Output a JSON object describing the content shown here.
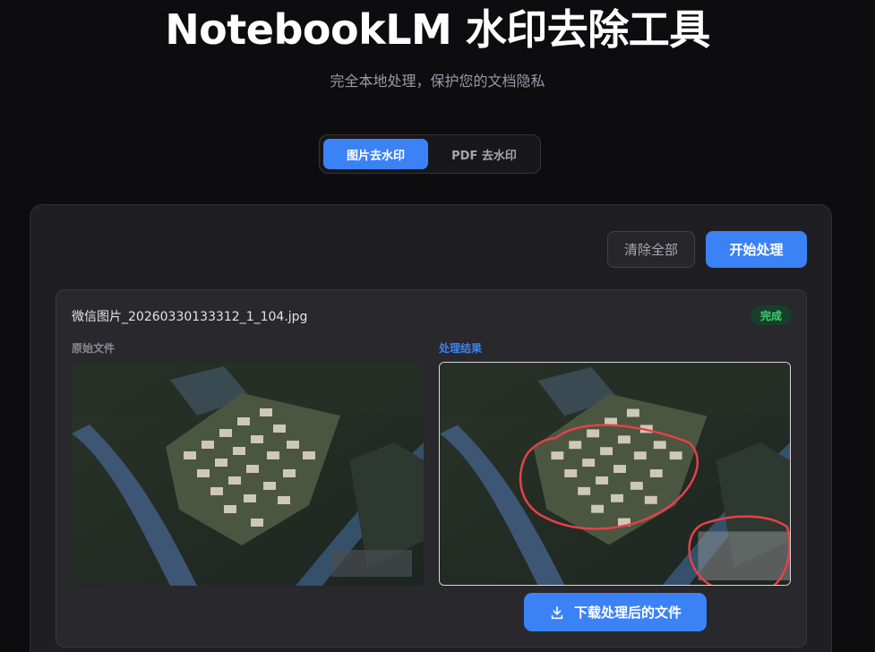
{
  "header": {
    "title": "NotebookLM 水印去除工具",
    "subtitle": "完全本地处理，保护您的文档隐私"
  },
  "tabs": [
    {
      "label": "图片去水印",
      "active": true
    },
    {
      "label": "PDF 去水印",
      "active": false
    }
  ],
  "toolbar": {
    "clear_label": "清除全部",
    "start_label": "开始处理"
  },
  "file": {
    "name": "微信图片_20260330133312_1_104.jpg",
    "status": "完成",
    "original_label": "原始文件",
    "result_label": "处理结果",
    "download_label": "下载处理后的文件"
  },
  "colors": {
    "accent": "#3b82f6",
    "success": "#3fcf73",
    "annotation": "#e8404a"
  }
}
